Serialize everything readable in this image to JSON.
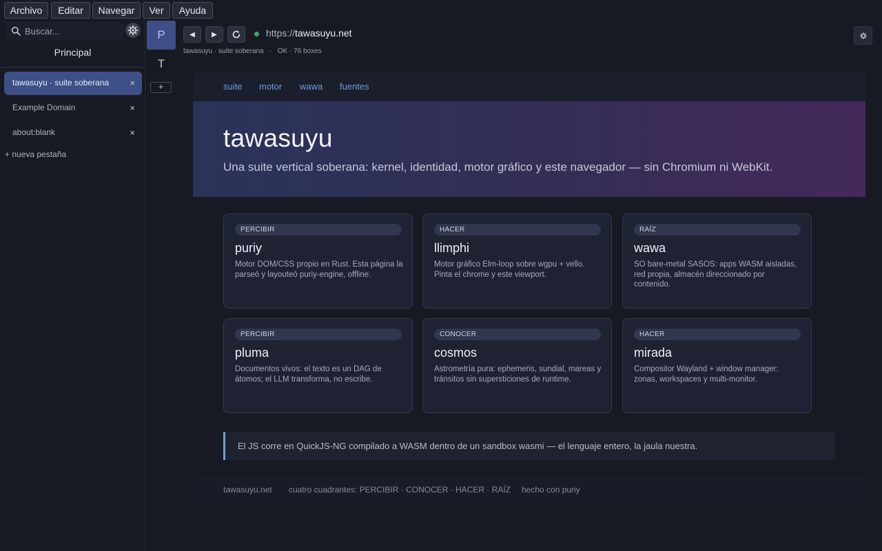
{
  "menubar": {
    "items": [
      "Archivo",
      "Editar",
      "Navegar",
      "Ver",
      "Ayuda"
    ]
  },
  "sidebar": {
    "search": {
      "placeholder": "Buscar..."
    },
    "group_title": "Principal",
    "tabs": [
      {
        "label": "tawasuyu · suite soberana",
        "active": true
      },
      {
        "label": "Example Domain",
        "active": false
      },
      {
        "label": "about:blank",
        "active": false
      }
    ],
    "close_glyph": "×",
    "new_tab_label": "+ nueva pestaña"
  },
  "workspaces": {
    "items": [
      "P",
      "T"
    ],
    "active": "P",
    "add_label": "+"
  },
  "toolbar": {
    "back_glyph": "◀",
    "forward_glyph": "▶",
    "url_scheme": "https://",
    "url_host": "tawasuyu.net",
    "status_line": "tawasuyu · suite soberana   ·   OK · 76 boxes",
    "secure_color": "#3fa66e"
  },
  "page": {
    "nav": [
      "suite",
      "motor",
      "wawa",
      "fuentes"
    ],
    "hero": {
      "title": "tawasuyu",
      "subtitle": "Una suite vertical soberana: kernel, identidad, motor gráfico y este navegador — sin Chromium ni WebKit."
    },
    "cards": [
      {
        "badge": "PERCIBIR",
        "title": "puriy",
        "desc": "Motor DOM/CSS propio en Rust. Esta página la parseó y layouteó puriy-engine, offline."
      },
      {
        "badge": "HACER",
        "title": "llimphi",
        "desc": "Motor gráfico Elm-loop sobre wgpu + vello. Pinta el chrome y este viewport."
      },
      {
        "badge": "RAÍZ",
        "title": "wawa",
        "desc": "SO bare-metal SASOS: apps WASM aisladas, red propia, almacén direccionado por contenido."
      },
      {
        "badge": "PERCIBIR",
        "title": "pluma",
        "desc": "Documentos vivos: el texto es un DAG de átomos; el LLM transforma, no escribe."
      },
      {
        "badge": "CONOCER",
        "title": "cosmos",
        "desc": "Astrometría pura: ephemeris, sundial, mareas y tránsitos sin supersticiones de runtime."
      },
      {
        "badge": "HACER",
        "title": "mirada",
        "desc": "Compositor Wayland + window manager: zonas, workspaces y multi-monitor."
      }
    ],
    "quote": "El JS corre en QuickJS-NG compilado a WASM dentro de un sandbox wasmi — el lenguaje entero, la jaula nuestra.",
    "footer": [
      "tawasuyu.net",
      "cuatro cuadrantes: PERCIBIR · CONOCER · HACER · RAÍZ",
      "hecho con puriy"
    ]
  },
  "colors": {
    "accent": "#3d4f86",
    "link": "#6f9ae3",
    "quote_border": "#6ba4cc"
  },
  "icons": {
    "search": "search-icon",
    "gear": "gear-icon",
    "reload": "reload-icon",
    "settings": "settings-icon"
  }
}
